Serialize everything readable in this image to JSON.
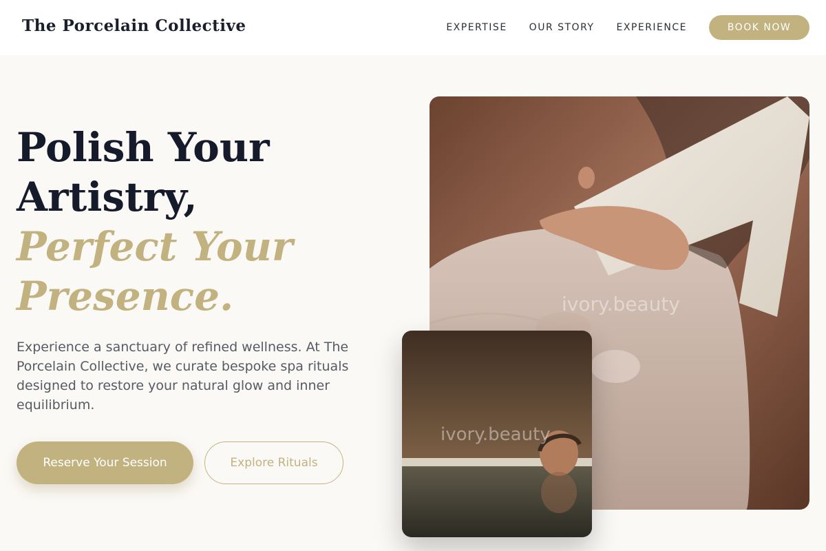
{
  "brand": {
    "name": "The Porcelain Collective"
  },
  "nav": {
    "items": [
      {
        "label": "EXPERTISE"
      },
      {
        "label": "OUR STORY"
      },
      {
        "label": "EXPERIENCE"
      }
    ],
    "cta": "BOOK NOW"
  },
  "hero": {
    "title_line1": "Polish Your",
    "title_line2": "Artistry,",
    "title_accent_line1": "Perfect Your",
    "title_accent_line2": "Presence.",
    "description": "Experience a sanctuary of refined wellness. At The Porcelain Collective, we curate bespoke spa rituals designed to restore your natural glow and inner equilibrium.",
    "primary_button": "Reserve Your Session",
    "secondary_button": "Explore Rituals"
  },
  "images": {
    "main_watermark": "ivory.beauty",
    "small_watermark": "ivory.beauty"
  },
  "colors": {
    "accent": "#c2b280",
    "heading": "#161b2b",
    "background": "#fbf9f6"
  }
}
